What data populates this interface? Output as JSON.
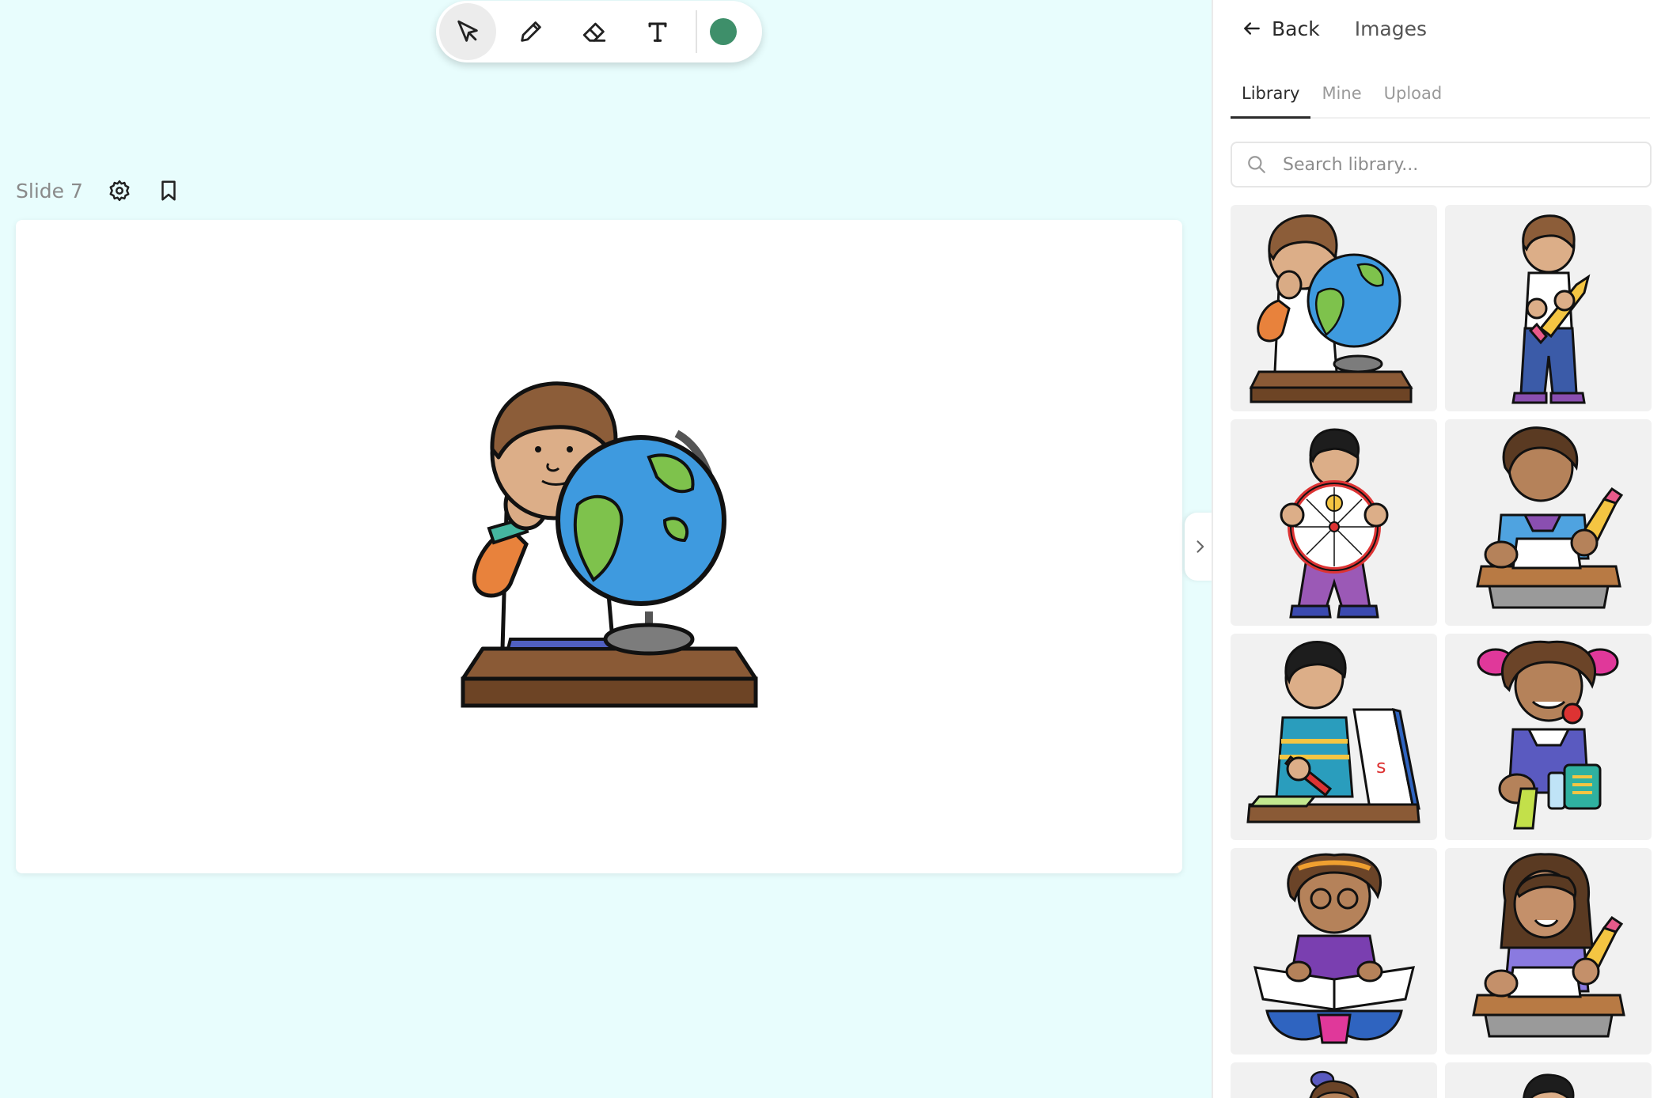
{
  "toolbar": {
    "tools": [
      {
        "name": "select",
        "icon": "cursor-arrow-icon",
        "active": true
      },
      {
        "name": "pen",
        "icon": "pencil-icon",
        "active": false
      },
      {
        "name": "eraser",
        "icon": "eraser-icon",
        "active": false
      },
      {
        "name": "text",
        "icon": "text-T-icon",
        "active": false
      }
    ],
    "current_color": "#3e8f6a"
  },
  "slide": {
    "label": "Slide 7",
    "settings_icon": "gear-icon",
    "bookmark_icon": "bookmark-icon",
    "content": "clipart-boy-with-globe"
  },
  "panel": {
    "back_label": "Back",
    "title": "Images",
    "tabs": [
      {
        "label": "Library",
        "active": true
      },
      {
        "label": "Mine",
        "active": false
      },
      {
        "label": "Upload",
        "active": false
      }
    ],
    "search_placeholder": "Search library...",
    "images": [
      {
        "icon": "boy-with-globe-clipart"
      },
      {
        "icon": "boy-with-pencil-clipart"
      },
      {
        "icon": "boy-with-weather-wheel-clipart"
      },
      {
        "icon": "girl-writing-at-desk-clipart"
      },
      {
        "icon": "boy-writing-at-desk-clipart"
      },
      {
        "icon": "girl-with-lunchbox-clipart"
      },
      {
        "icon": "girl-reading-book-clipart"
      },
      {
        "icon": "girl-with-pencil-at-desk-clipart"
      }
    ]
  },
  "colors": {
    "background": "#e8fdfd",
    "accent_color_dot": "#3e8f6a"
  }
}
